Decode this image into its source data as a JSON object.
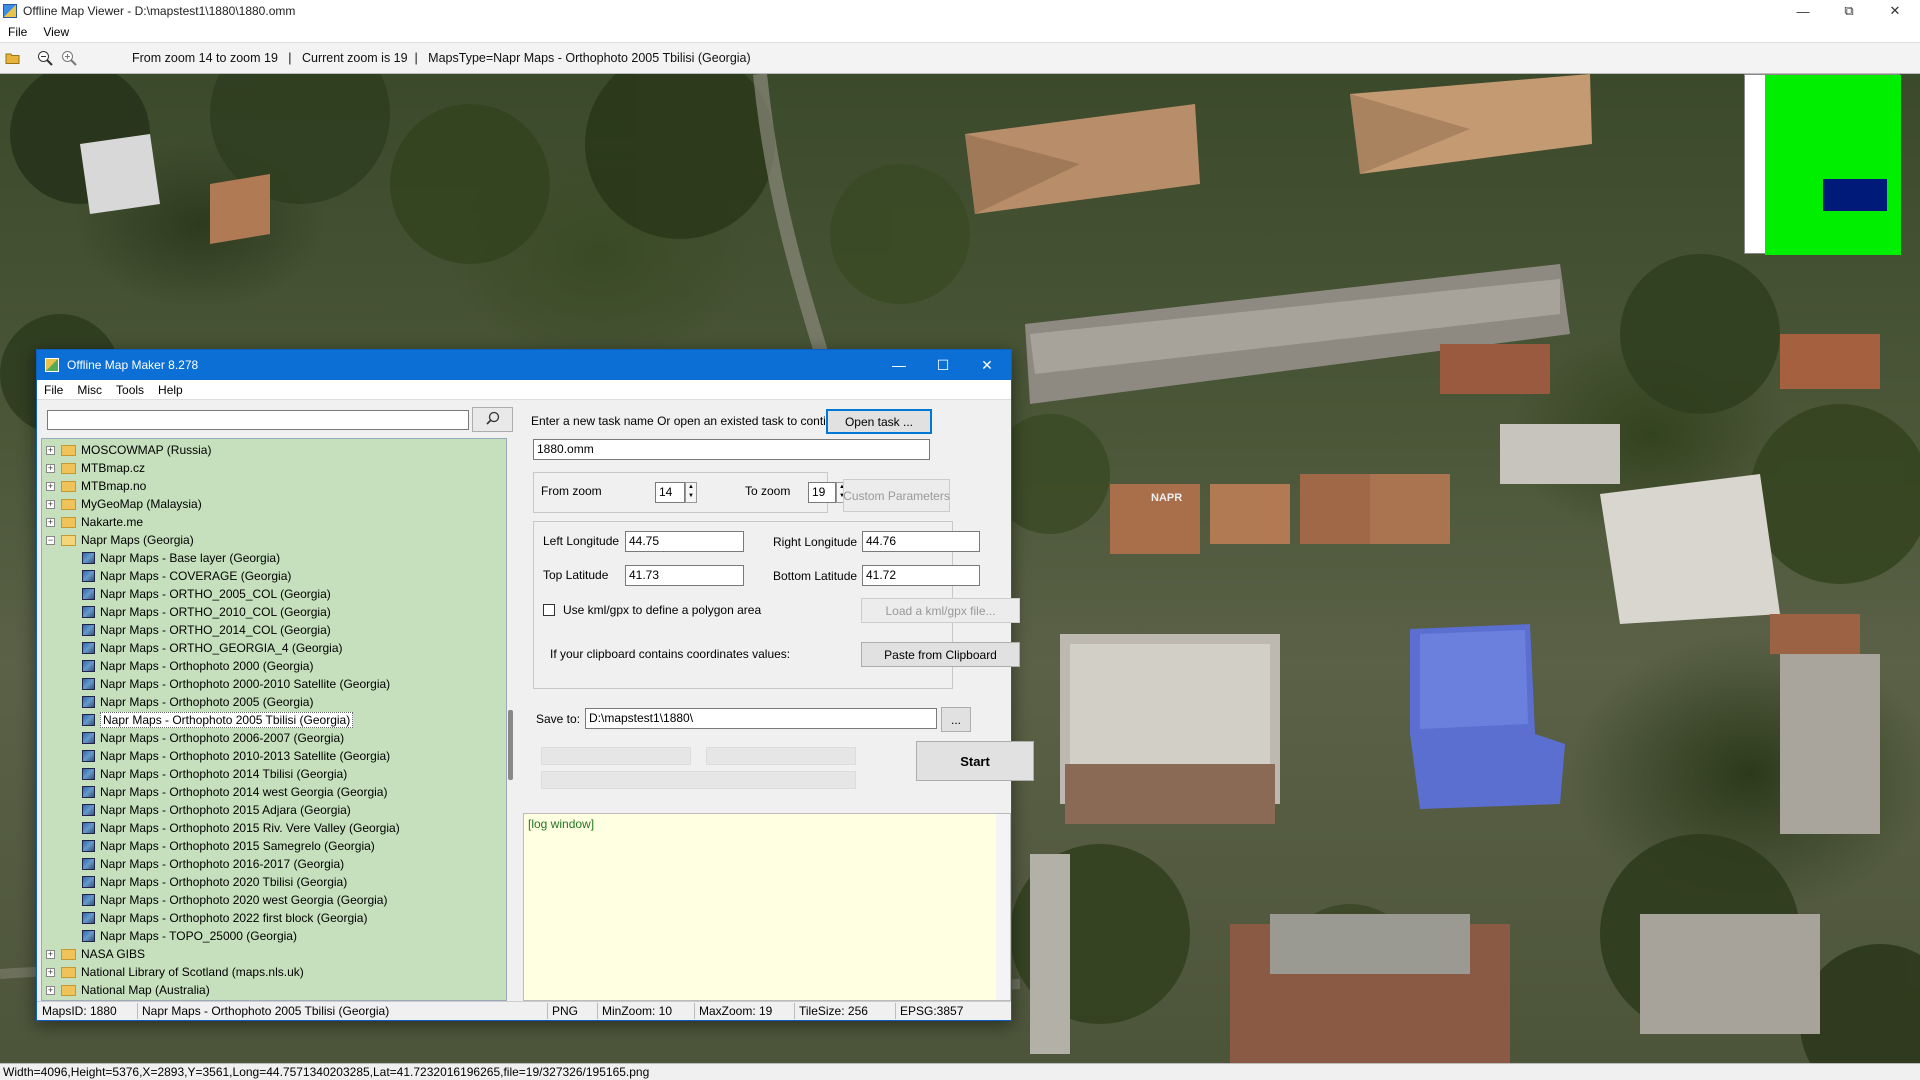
{
  "viewer": {
    "title": "Offline Map Viewer - D:\\mapstest1\\1880\\1880.omm",
    "menu": [
      "File",
      "View"
    ],
    "toolbar_info": "From zoom 14 to zoom 19   |   Current zoom is 19  |   MapsType=Napr Maps - Orthophoto 2005 Tbilisi (Georgia)",
    "map_label": "NAPR",
    "status": "Width=4096,Height=5376,X=2893,Y=3561,Long=44.7571340203285,Lat=41.7232016196265,file=19/327326/195165.png"
  },
  "icons": {
    "open": "folder-open-icon",
    "zoom_out": "zoom-out-icon",
    "zoom_in": "zoom-in-icon",
    "search": "search-icon"
  },
  "colors": {
    "tree_bg": "#c6e0bd",
    "title_bar": "#0b6fd6",
    "minimap_green": "#00ee00",
    "minimap_navy": "#001a7a",
    "log_bg": "#ffffe1"
  },
  "omm": {
    "title": "Offline Map Maker 8.278",
    "menu": [
      "File",
      "Misc",
      "Tools",
      "Help"
    ],
    "search_value": "",
    "tree": [
      {
        "label": "MOSCOWMAP (Russia)",
        "type": "folder"
      },
      {
        "label": "MTBmap.cz",
        "type": "folder"
      },
      {
        "label": "MTBmap.no",
        "type": "folder"
      },
      {
        "label": "MyGeoMap (Malaysia)",
        "type": "folder"
      },
      {
        "label": "Nakarte.me",
        "type": "folder"
      },
      {
        "label": "Napr Maps (Georgia)",
        "type": "folder-open"
      },
      {
        "label": "Napr Maps - Base layer (Georgia)",
        "type": "map"
      },
      {
        "label": "Napr Maps - COVERAGE (Georgia)",
        "type": "map"
      },
      {
        "label": "Napr Maps - ORTHO_2005_COL (Georgia)",
        "type": "map"
      },
      {
        "label": "Napr Maps - ORTHO_2010_COL (Georgia)",
        "type": "map"
      },
      {
        "label": "Napr Maps - ORTHO_2014_COL (Georgia)",
        "type": "map"
      },
      {
        "label": "Napr Maps - ORTHO_GEORGIA_4 (Georgia)",
        "type": "map"
      },
      {
        "label": "Napr Maps - Orthophoto 2000 (Georgia)",
        "type": "map"
      },
      {
        "label": "Napr Maps - Orthophoto 2000-2010 Satellite (Georgia)",
        "type": "map"
      },
      {
        "label": "Napr Maps - Orthophoto 2005 (Georgia)",
        "type": "map"
      },
      {
        "label": "Napr Maps - Orthophoto 2005 Tbilisi (Georgia)",
        "type": "map",
        "selected": true
      },
      {
        "label": "Napr Maps - Orthophoto 2006-2007 (Georgia)",
        "type": "map"
      },
      {
        "label": "Napr Maps - Orthophoto 2010-2013 Satellite (Georgia)",
        "type": "map"
      },
      {
        "label": "Napr Maps - Orthophoto 2014 Tbilisi (Georgia)",
        "type": "map"
      },
      {
        "label": "Napr Maps - Orthophoto 2014 west Georgia (Georgia)",
        "type": "map"
      },
      {
        "label": "Napr Maps - Orthophoto 2015 Adjara (Georgia)",
        "type": "map"
      },
      {
        "label": "Napr Maps - Orthophoto 2015 Riv. Vere Valley (Georgia)",
        "type": "map"
      },
      {
        "label": "Napr Maps - Orthophoto 2015 Samegrelo (Georgia)",
        "type": "map"
      },
      {
        "label": "Napr Maps - Orthophoto 2016-2017 (Georgia)",
        "type": "map"
      },
      {
        "label": "Napr Maps - Orthophoto 2020 Tbilisi (Georgia)",
        "type": "map"
      },
      {
        "label": "Napr Maps - Orthophoto 2020 west Georgia (Georgia)",
        "type": "map"
      },
      {
        "label": "Napr Maps - Orthophoto 2022 first block (Georgia)",
        "type": "map"
      },
      {
        "label": "Napr Maps - TOPO_25000 (Georgia)",
        "type": "map"
      },
      {
        "label": "NASA GIBS",
        "type": "folder"
      },
      {
        "label": "National Library of Scotland (maps.nls.uk)",
        "type": "folder"
      },
      {
        "label": "National Map (Australia)",
        "type": "folder"
      }
    ],
    "task_prompt": "Enter a new task name Or open an existed task to continue:",
    "open_task_label": "Open task ...",
    "task_name": "1880.omm",
    "from_zoom_label": "From zoom",
    "from_zoom": "14",
    "to_zoom_label": "To zoom",
    "to_zoom": "19",
    "custom_params_label": "Custom Parameters",
    "left_lon_label": "Left Longitude",
    "left_lon": "44.75",
    "right_lon_label": "Right Longitude",
    "right_lon": "44.76",
    "top_lat_label": "Top Latitude",
    "top_lat": "41.73",
    "bottom_lat_label": "Bottom Latitude",
    "bottom_lat": "41.72",
    "kml_label": "Use kml/gpx to define a polygon area",
    "kml_checked": false,
    "load_kml_label": "Load a kml/gpx file...",
    "clipboard_prompt": "If your clipboard contains coordinates values:",
    "paste_label": "Paste from Clipboard",
    "save_to_label": "Save to:",
    "save_to": "D:\\mapstest1\\1880\\",
    "browse_label": "...",
    "start_label": "Start",
    "log_text": "[log window]",
    "status": {
      "maps_id": "MapsID: 1880",
      "map_name": "Napr Maps - Orthophoto 2005 Tbilisi (Georgia)",
      "format": "PNG",
      "min_zoom": "MinZoom: 10",
      "max_zoom": "MaxZoom: 19",
      "tile_size": "TileSize: 256",
      "epsg": "EPSG:3857"
    }
  }
}
